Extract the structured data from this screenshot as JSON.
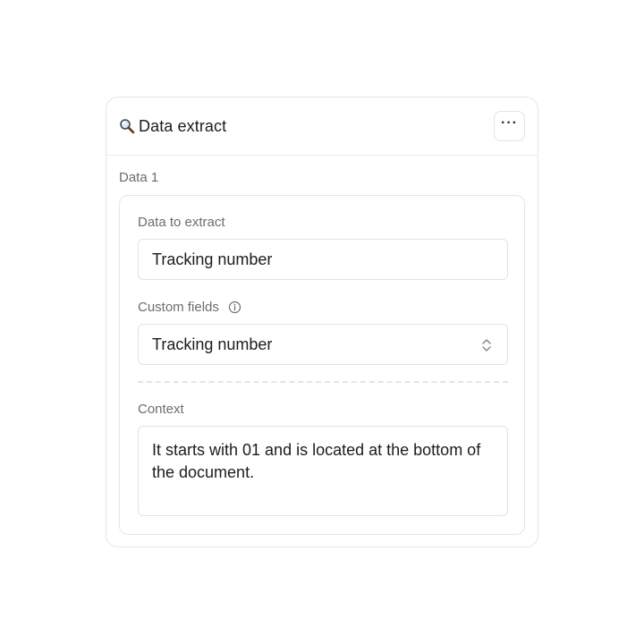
{
  "header": {
    "icon": "magnifier-icon",
    "title": "Data extract",
    "more_label": "···"
  },
  "section": {
    "label": "Data 1"
  },
  "fields": {
    "extract_label": "Data to extract",
    "extract_value": "Tracking number",
    "custom_label": "Custom fields",
    "custom_info_icon": "info-icon",
    "custom_value": "Tracking number",
    "custom_chevron_icon": "chevron-up-down-icon",
    "context_label": "Context",
    "context_value": "It starts with 01 and is located at the bottom of the document."
  },
  "colors": {
    "border": "#e6e6e8",
    "label": "#6c6c72",
    "text": "#1c1c1f"
  }
}
